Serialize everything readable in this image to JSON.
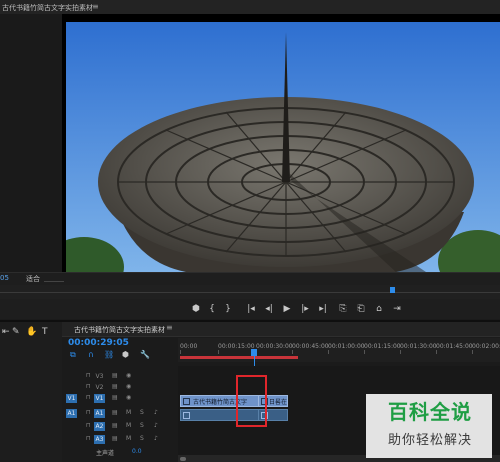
{
  "source_panel": {
    "tab_label": "古代书籍竹简古文字实拍素材",
    "menu_glyph": "≡"
  },
  "program_monitor": {
    "timecode": "05",
    "fit_label": "适合",
    "transport": [
      "⬢",
      "{",
      "}",
      "|◂",
      "◂|",
      "▶",
      "|▸",
      "▸|",
      "⎘",
      "⎗",
      "⌂",
      "⇥"
    ]
  },
  "tools": [
    "⇤",
    "✎",
    "✋",
    "T"
  ],
  "timeline": {
    "tab_label": "古代书籍竹简古文字实拍素材",
    "menu_glyph": "≡",
    "timecode": "00:00:29:05",
    "ruler_labels": [
      "00:00",
      "00:00:15:00",
      "00:00:30:00",
      "00:00:45:00",
      "00:01:00:00",
      "00:01:15:00",
      "00:01:30:00",
      "00:01:45:00",
      "00:02:00:00"
    ],
    "tracks": [
      {
        "name": "V3",
        "src": "",
        "m": "",
        "s": ""
      },
      {
        "name": "V2",
        "src": "",
        "m": "",
        "s": ""
      },
      {
        "name": "V1",
        "src": "V1",
        "m": "",
        "s": ""
      },
      {
        "name": "A1",
        "src": "A1",
        "m": "M",
        "s": "S"
      },
      {
        "name": "A2",
        "src": "",
        "m": "M",
        "s": "S"
      },
      {
        "name": "A3",
        "src": "",
        "m": "M",
        "s": "S"
      }
    ],
    "master_label": "主声道",
    "master_value": "0.0",
    "video_clip_label": "古代书籍竹简古文字",
    "video_clip2_label": "日晷在",
    "playhead_percent": 22.6
  },
  "watermark": {
    "line1": "百科全说",
    "line2": "助你轻松解决"
  },
  "colors": {
    "accent": "#2d8ceb",
    "highlight_box": "#e0262b",
    "video_clip": "#6f93c9",
    "audio_clip": "#3a5f86"
  }
}
